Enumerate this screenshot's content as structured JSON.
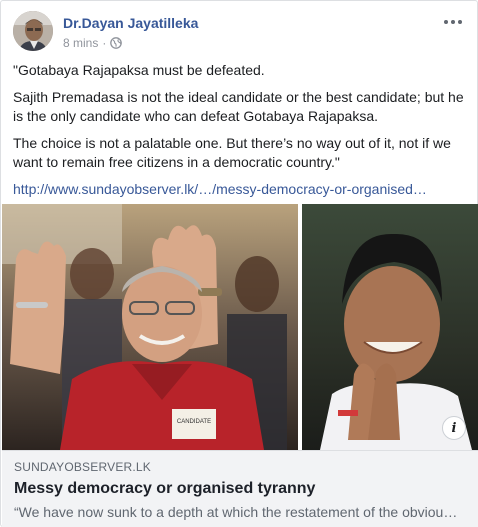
{
  "post": {
    "author": "Dr.Dayan Jayatilleka",
    "time": "8 mins",
    "separator": "·",
    "privacy_icon": "globe-icon",
    "more_icon": "more-options-icon",
    "paragraphs": [
      "\"Gotabaya Rajapaksa must be defeated.",
      "Sajith Premadasa is not the ideal candidate or the best candidate; but he is the only candidate who can defeat Gotabaya Rajapaksa.",
      "The choice is not a palatable one. But there’s no way out of it, not if we want to remain free citizens in a democratic country.\""
    ],
    "link_url": "http://www.sundayobserver.lk/…/messy-democracy-or-organised…"
  },
  "preview": {
    "info_label": "i",
    "badge_text": "CANDIDATE",
    "domain": "SUNDAYOBSERVER.LK",
    "title": "Messy democracy or organised tyranny",
    "description": "“We have now sunk to a depth at which the restatement of the obviou…"
  },
  "colors": {
    "link": "#385898",
    "meta": "#90949c",
    "preview_bg": "#f2f3f5",
    "shirt_red": "#b8232a"
  }
}
